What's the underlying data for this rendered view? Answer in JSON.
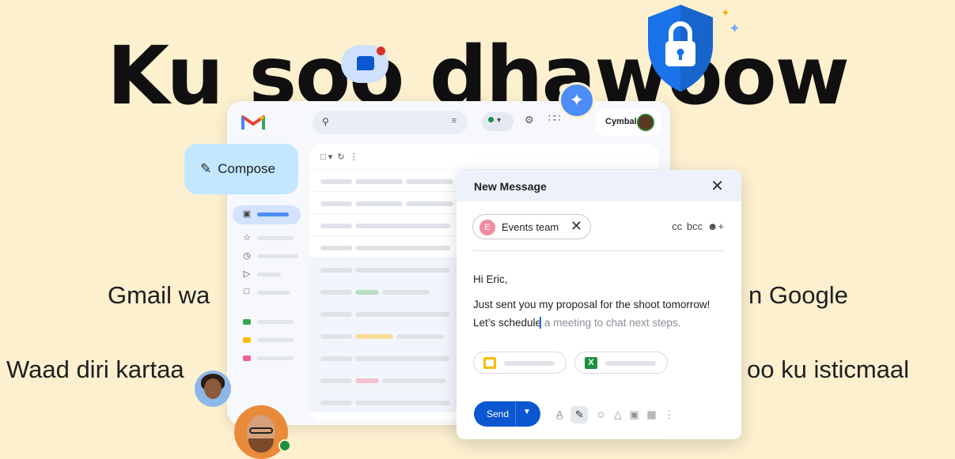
{
  "hero": {
    "headline": "Ku soo dhawoow",
    "line1_left": "Gmail wa",
    "line1_right": "n Google",
    "line2_left": "Waad diri kartaa",
    "line2_right": "oo ku isticmaal"
  },
  "gmail": {
    "brand_name": "Cymbal",
    "compose_label": "Compose"
  },
  "new_message": {
    "title": "New Message",
    "recipient_initial": "E",
    "recipient": "Events team",
    "cc": "cc",
    "bcc": "bcc",
    "greeting": "Hi Eric,",
    "body_line1": "Just sent you my proposal for the shoot tomorrow!",
    "body_line2_typed": "Let’s schedule",
    "body_line2_suggestion": " a meeting to chat next steps.",
    "send_label": "Send"
  },
  "colors": {
    "background": "#fdf0cf",
    "accent": "#0b57d0",
    "compose_bg": "#c2e7ff"
  },
  "icons": [
    "search-icon",
    "filter-icon",
    "settings-icon",
    "apps-icon",
    "pencil-icon",
    "close-icon",
    "add-people-icon",
    "chat-icon",
    "gemini-icon",
    "lock-shield-icon"
  ]
}
